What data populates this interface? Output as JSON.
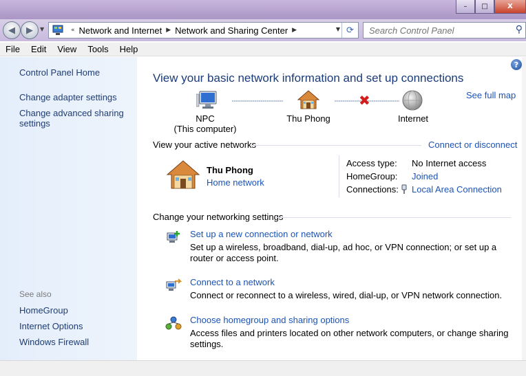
{
  "window": {
    "minimize_glyph": "–",
    "maximize_glyph": "□",
    "close_glyph": "X"
  },
  "navbar": {
    "back_icon": "back-arrow-icon",
    "forward_icon": "forward-arrow-icon",
    "breadcrumb_prefix": "«",
    "breadcrumb": [
      "Network and Internet",
      "Network and Sharing Center"
    ],
    "search_placeholder": "Search Control Panel"
  },
  "menu": [
    "File",
    "Edit",
    "View",
    "Tools",
    "Help"
  ],
  "sidebar": {
    "home": "Control Panel Home",
    "links": [
      "Change adapter settings",
      "Change advanced sharing settings"
    ],
    "see_also_label": "See also",
    "see_also": [
      "HomeGroup",
      "Internet Options",
      "Windows Firewall"
    ]
  },
  "main": {
    "title": "View your basic network information and set up connections",
    "see_full_map": "See full map",
    "map": {
      "computer_name": "NPC",
      "computer_sub": "(This computer)",
      "network_name": "Thu Phong",
      "internet": "Internet"
    },
    "active_networks": {
      "heading": "View your active networks",
      "connect_link": "Connect or disconnect",
      "name": "Thu Phong",
      "type": "Home network",
      "access_type_label": "Access type:",
      "access_type_value": "No Internet access",
      "homegroup_label": "HomeGroup:",
      "homegroup_value": "Joined",
      "connections_label": "Connections:",
      "connections_value": "Local Area Connection"
    },
    "change_settings": {
      "heading": "Change your networking settings",
      "tasks": [
        {
          "icon": "new-connection-icon",
          "link": "Set up a new connection or network",
          "desc": "Set up a wireless, broadband, dial-up, ad hoc, or VPN connection; or set up a router or access point."
        },
        {
          "icon": "connect-network-icon",
          "link": "Connect to a network",
          "desc": "Connect or reconnect to a wireless, wired, dial-up, or VPN network connection."
        },
        {
          "icon": "homegroup-icon",
          "link": "Choose homegroup and sharing options",
          "desc": "Access files and printers located on other network computers, or change sharing settings."
        }
      ]
    }
  },
  "colors": {
    "link": "#1b53b5",
    "title": "#1a3b78",
    "sidebar_bg": "#e4eefb",
    "error_x": "#d21d1d"
  }
}
